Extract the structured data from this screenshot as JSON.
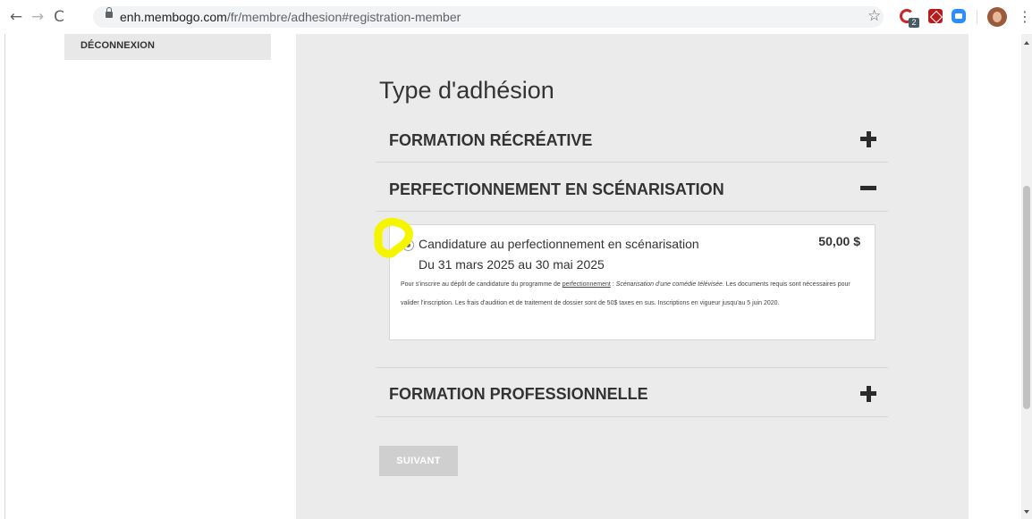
{
  "browser": {
    "url_host": "enh.membogo.com",
    "url_path": "/fr/membre/adhesion#registration-member",
    "extension_badge": "2"
  },
  "sidebar": {
    "logout_label": "DÉCONNEXION"
  },
  "membership": {
    "title": "Type d'adhésion",
    "sections": [
      {
        "label": "FORMATION RÉCRÉATIVE",
        "state": "collapsed"
      },
      {
        "label": "PERFECTIONNEMENT EN SCÉNARISATION",
        "state": "expanded"
      },
      {
        "label": "FORMATION PROFESSIONNELLE",
        "state": "collapsed"
      }
    ],
    "option": {
      "name": "Candidature au perfectionnement en scénarisation",
      "price": "50,00 $",
      "dates": "Du 31 mars 2025 au 30 mai 2025",
      "desc_part1": "Pour s'inscrire au dépôt de candidature du programme de ",
      "desc_link": "perfectionnement",
      "desc_part2": " : ",
      "desc_italic": "Scénarisation d'une comédie télévisée",
      "desc_part3": ". Les documents requis sont nécessaires pour valider l'inscription. Les frais d'audition et de traitement de dossier sont de 50$ taxes en sus. Inscriptions en vigueur jusqu'au 5 juin 2020.",
      "selected": true
    },
    "next_label": "SUIVANT"
  },
  "colors": {
    "panel_bg": "#ebebeb",
    "highlight": "#f5f500",
    "button_disabled": "#cfcfcf"
  }
}
